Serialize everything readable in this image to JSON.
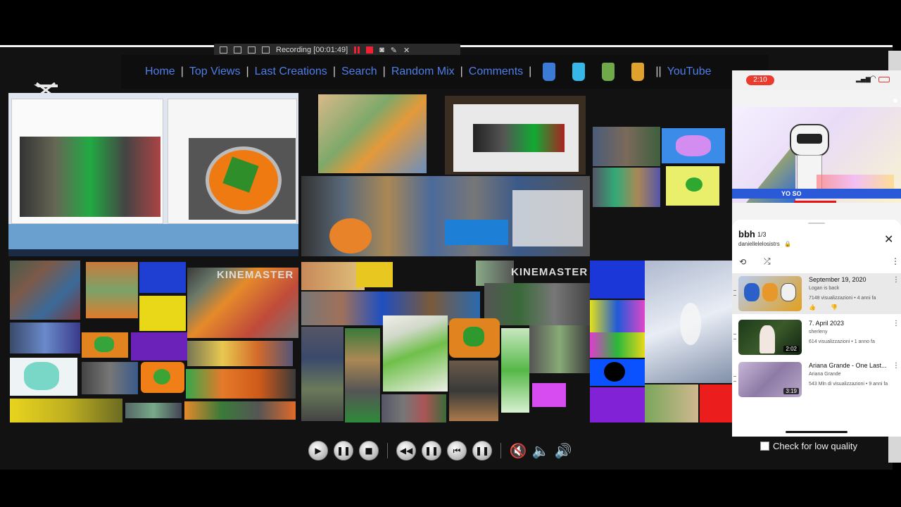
{
  "recorder": {
    "label": "Recording [00:01:49]"
  },
  "nav": {
    "links": [
      "Home",
      "Top Views",
      "Last Creations",
      "Search",
      "Random Mix",
      "Comments"
    ],
    "youtube_label": "YouTube",
    "cup_colors": [
      "#3c7ad8",
      "#35b8e8",
      "#6fa94a",
      "#e0a22c"
    ]
  },
  "mosaic": {
    "kinemaster_label_1": "KINEMASTER",
    "kinemaster_label_2": "KINEMASTER"
  },
  "controls": {
    "buttons": [
      "play-icon",
      "pause-icon",
      "stop-icon",
      "rewind-icon",
      "pause-icon",
      "previous-icon",
      "pause-icon"
    ],
    "volume": [
      "mute-icon",
      "volume-low-icon",
      "volume-high-icon"
    ]
  },
  "low_quality": {
    "label": "Check for low quality"
  },
  "phone": {
    "status_time": "2:10",
    "video_caption": "YO SO",
    "playlist": {
      "title": "bbh",
      "position": "1/3",
      "owner": "daniellelelosistrs",
      "items": [
        {
          "title": "September 19, 2020",
          "channel": "Logan is back",
          "stats": "7148 visualizzazioni • 4 anni fa",
          "duration": ""
        },
        {
          "title": "7. April 2023",
          "channel": "sherleny",
          "stats": "614 visualizzazioni • 1 anno fa",
          "duration": "2:02"
        },
        {
          "title": "Ariana Grande - One Last...",
          "channel": "Ariana Grande",
          "stats": "543 Mln di visualizzazioni • 9 anni fa",
          "duration": "3:19"
        }
      ]
    }
  }
}
